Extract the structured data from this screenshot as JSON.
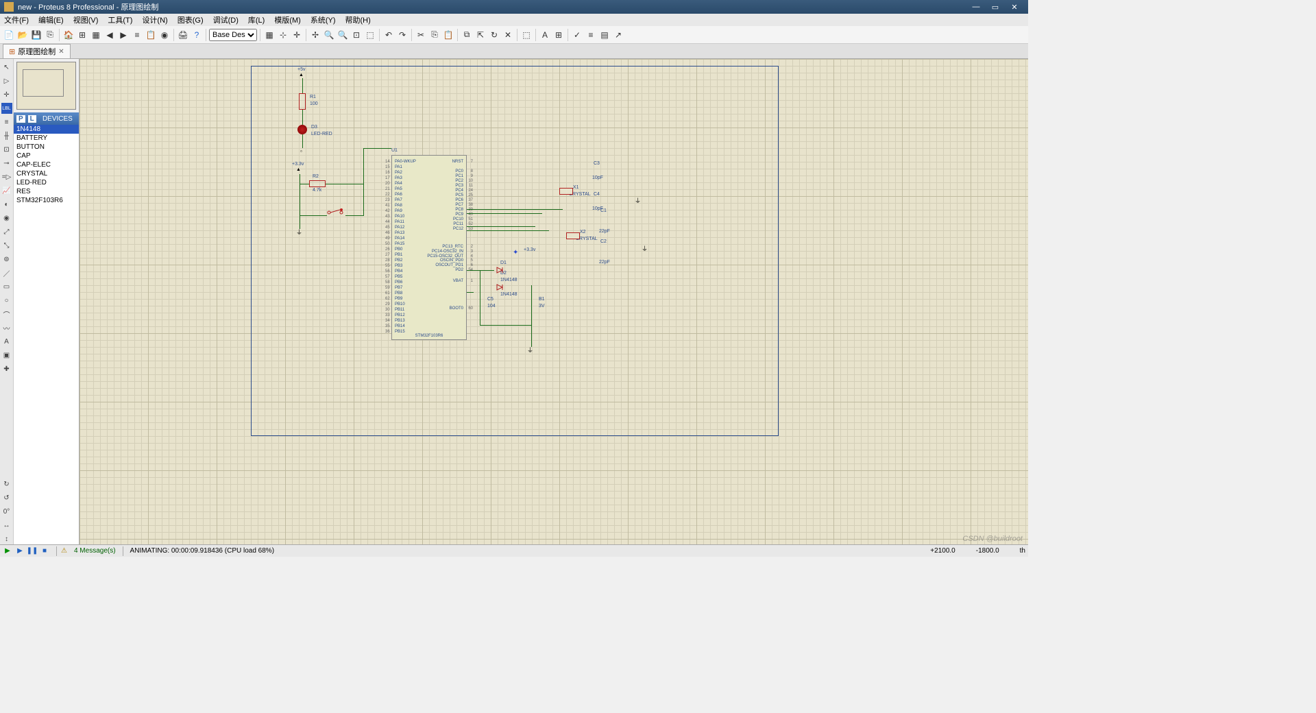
{
  "title": "new - Proteus 8 Professional - 原理图绘制",
  "menu": [
    "文件(F)",
    "编辑(E)",
    "视图(V)",
    "工具(T)",
    "设计(N)",
    "图表(G)",
    "调试(D)",
    "库(L)",
    "模版(M)",
    "系统(Y)",
    "帮助(H)"
  ],
  "design_dropdown": "Base Design",
  "tab": {
    "label": "原理图绘制"
  },
  "devices_header": "DEVICES",
  "devices_p": "P",
  "devices_l": "L",
  "devices": [
    "1N4148",
    "BATTERY",
    "BUTTON",
    "CAP",
    "CAP-ELEC",
    "CRYSTAL",
    "LED-RED",
    "RES",
    "STM32F103R6"
  ],
  "devices_selected": "1N4148",
  "lefttools_angle": "0°",
  "components": {
    "U1": {
      "ref": "U1",
      "part": "STM32F103R6"
    },
    "R1": {
      "ref": "R1",
      "val": "100"
    },
    "R2": {
      "ref": "R2",
      "val": "4.7k"
    },
    "D3": {
      "ref": "D3",
      "val": "LED-RED"
    },
    "D1": {
      "ref": "D1",
      "val": "1N4148"
    },
    "D2": {
      "ref": "D2",
      "val": "1N4148"
    },
    "C1": {
      "ref": "C1",
      "val": "22pF"
    },
    "C2": {
      "ref": "C2",
      "val": "22pF"
    },
    "C3": {
      "ref": "C3",
      "val": "10pF"
    },
    "C4": {
      "ref": "C4",
      "val": "10pF"
    },
    "C5": {
      "ref": "C5",
      "val": "104"
    },
    "X1": {
      "ref": "X1",
      "val": "CRYSTAL"
    },
    "X2": {
      "ref": "X2",
      "val": "CRYSTAL"
    },
    "B1": {
      "ref": "B1",
      "val": "3V"
    }
  },
  "power": {
    "v5": "+5v",
    "v33a": "+3.3v",
    "v33b": "+3.3v"
  },
  "mcu_pins_left": [
    {
      "n": "14",
      "name": "PA0-WKUP"
    },
    {
      "n": "15",
      "name": "PA1"
    },
    {
      "n": "16",
      "name": "PA2"
    },
    {
      "n": "17",
      "name": "PA3"
    },
    {
      "n": "20",
      "name": "PA4"
    },
    {
      "n": "21",
      "name": "PA5"
    },
    {
      "n": "22",
      "name": "PA6"
    },
    {
      "n": "23",
      "name": "PA7"
    },
    {
      "n": "41",
      "name": "PA8"
    },
    {
      "n": "42",
      "name": "PA9"
    },
    {
      "n": "43",
      "name": "PA10"
    },
    {
      "n": "44",
      "name": "PA11"
    },
    {
      "n": "45",
      "name": "PA12"
    },
    {
      "n": "46",
      "name": "PA13"
    },
    {
      "n": "49",
      "name": "PA14"
    },
    {
      "n": "50",
      "name": "PA15"
    },
    {
      "n": "26",
      "name": "PB0"
    },
    {
      "n": "27",
      "name": "PB1"
    },
    {
      "n": "28",
      "name": "PB2"
    },
    {
      "n": "55",
      "name": "PB3"
    },
    {
      "n": "56",
      "name": "PB4"
    },
    {
      "n": "57",
      "name": "PB5"
    },
    {
      "n": "58",
      "name": "PB6"
    },
    {
      "n": "59",
      "name": "PB7"
    },
    {
      "n": "61",
      "name": "PB8"
    },
    {
      "n": "62",
      "name": "PB9"
    },
    {
      "n": "29",
      "name": "PB10"
    },
    {
      "n": "30",
      "name": "PB11"
    },
    {
      "n": "33",
      "name": "PB12"
    },
    {
      "n": "34",
      "name": "PB13"
    },
    {
      "n": "35",
      "name": "PB14"
    },
    {
      "n": "36",
      "name": "PB15"
    }
  ],
  "mcu_pins_right": [
    {
      "n": "7",
      "name": "NRST"
    },
    {
      "n": "8",
      "name": "PC0"
    },
    {
      "n": "9",
      "name": "PC1"
    },
    {
      "n": "10",
      "name": "PC2"
    },
    {
      "n": "11",
      "name": "PC3"
    },
    {
      "n": "24",
      "name": "PC4"
    },
    {
      "n": "25",
      "name": "PC5"
    },
    {
      "n": "37",
      "name": "PC6"
    },
    {
      "n": "38",
      "name": "PC7"
    },
    {
      "n": "39",
      "name": "PC8"
    },
    {
      "n": "40",
      "name": "PC9"
    },
    {
      "n": "51",
      "name": "PC10"
    },
    {
      "n": "52",
      "name": "PC11"
    },
    {
      "n": "53",
      "name": "PC12"
    },
    {
      "n": "2",
      "name": "PC13_RTC"
    },
    {
      "n": "3",
      "name": "PC14-OSC32_IN"
    },
    {
      "n": "4",
      "name": "PC15-OSC32_OUT"
    },
    {
      "n": "5",
      "name": "OSCIN_PD0"
    },
    {
      "n": "6",
      "name": "OSCOUT_PD1"
    },
    {
      "n": "54",
      "name": "PD2"
    },
    {
      "n": "1",
      "name": "VBAT"
    },
    {
      "n": "60",
      "name": "BOOT0"
    }
  ],
  "status": {
    "messages": "4 Message(s)",
    "anim": "ANIMATING: 00:00:09.918436 (CPU load 68%)",
    "coord_x": "+2100.0",
    "coord_y": "-1800.0",
    "unit": "th"
  },
  "watermark": "CSDN @buildroot"
}
